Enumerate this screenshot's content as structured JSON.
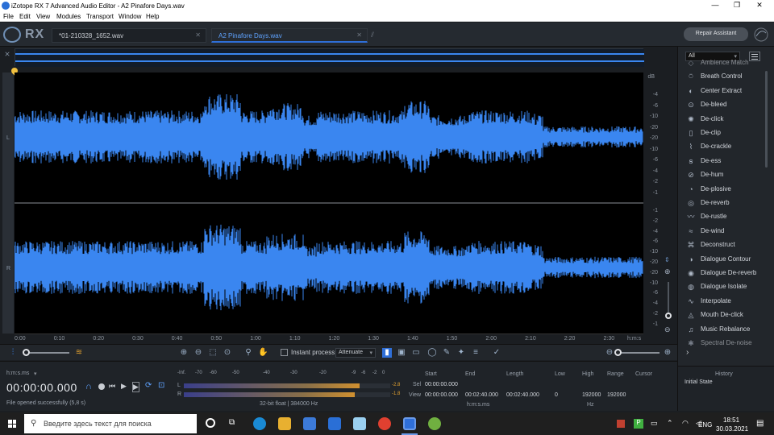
{
  "window": {
    "title": "iZotope RX 7 Advanced Audio Editor - A2 Pinafore Days.wav"
  },
  "menu": [
    "File",
    "Edit",
    "View",
    "Modules",
    "Transport",
    "Window",
    "Help"
  ],
  "logo": "RX",
  "tabs": [
    {
      "label": "*01-210328_1652.wav",
      "active": false
    },
    {
      "label": "A2 Pinafore Days.wav",
      "active": true
    }
  ],
  "repair_button": "Repair Assistant",
  "channels": {
    "left": "L",
    "right": "R"
  },
  "db_scale": {
    "unit": "dB",
    "left_ticks": [
      "-4",
      "-6",
      "-10",
      "-20",
      "-20",
      "-10",
      "-6",
      "-4",
      "-2",
      "-1"
    ],
    "right_ticks": [
      "-1",
      "-2",
      "-4",
      "-6",
      "-10",
      "-20",
      "-20",
      "-10",
      "-6",
      "-4",
      "-2",
      "-1"
    ]
  },
  "time_ruler": [
    "0:00",
    "0:10",
    "0:20",
    "0:30",
    "0:40",
    "0:50",
    "1:00",
    "1:10",
    "1:20",
    "1:30",
    "1:40",
    "1:50",
    "2:00",
    "2:10",
    "2:20",
    "2:30",
    "h:m:s"
  ],
  "toolbar": {
    "instant_process": "Instant process",
    "attenuate": "Attenuate"
  },
  "transport": {
    "format": "h:m:s.ms",
    "timecode": "00:00:00.000",
    "status": "File opened successfully (5,8 s)"
  },
  "meter": {
    "scale": [
      "-Inf.",
      "-70",
      "-60",
      "-50",
      "-40",
      "-30",
      "-20",
      "-9",
      "-6",
      "-2",
      "0"
    ],
    "left_label": "L",
    "right_label": "R",
    "left_peak": "-2.8",
    "right_peak": "-1.8",
    "format": "32-bit float | 384000 Hz",
    "left_level": 0.85,
    "right_level": 0.83
  },
  "selection": {
    "headers": {
      "start": "Start",
      "end": "End",
      "length": "Length",
      "low": "Low",
      "high": "High",
      "range": "Range",
      "cursor": "Cursor"
    },
    "sel_label": "Sel",
    "view_label": "View",
    "sel_start": "00:00:00.000",
    "view_start": "00:00:00.000",
    "view_end": "00:02:40.000",
    "view_length": "00:02:40.000",
    "low": "0",
    "high": "192000",
    "range": "192000",
    "time_unit": "h:m:s.ms",
    "freq_unit": "Hz"
  },
  "module_filter": "All",
  "modules": [
    "Ambience Match",
    "Breath Control",
    "Center Extract",
    "De-bleed",
    "De-click",
    "De-clip",
    "De-crackle",
    "De-ess",
    "De-hum",
    "De-plosive",
    "De-reverb",
    "De-rustle",
    "De-wind",
    "Deconstruct",
    "Dialogue Contour",
    "Dialogue De-reverb",
    "Dialogue Isolate",
    "Interpolate",
    "Mouth De-click",
    "Music Rebalance",
    "Spectral De-noise"
  ],
  "history": {
    "title": "History",
    "items": [
      "Initial State"
    ]
  },
  "taskbar": {
    "search_placeholder": "Введите здесь текст для поиска",
    "time": "18:51",
    "date": "30.03.2021",
    "lang": "ENG"
  },
  "colors": {
    "waveform": "#3a86f0",
    "accent": "#2f6fd8",
    "background": "#000000"
  }
}
